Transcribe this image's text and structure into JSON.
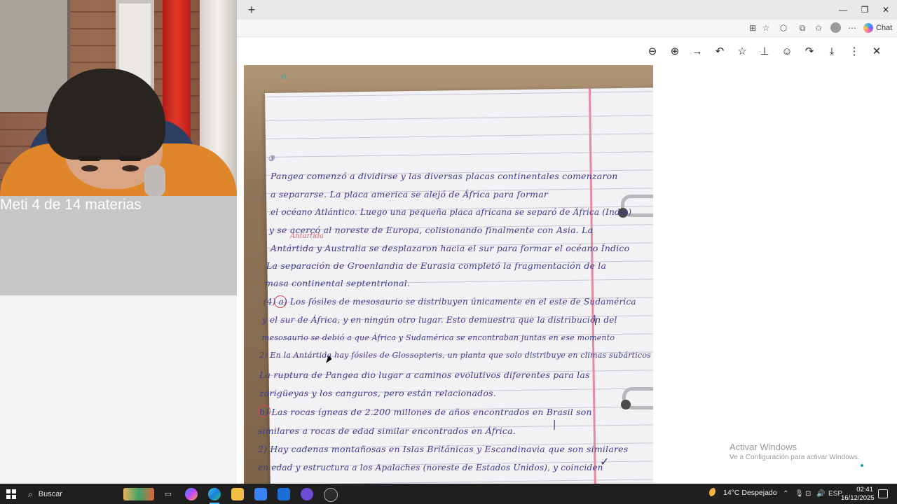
{
  "webcam": {
    "caption": "Meti 4 de 14 materias"
  },
  "browser": {
    "new_tab_icon": "plus-icon",
    "window_controls": [
      "minimize-icon",
      "restore-icon",
      "close-icon"
    ],
    "toolbar_icons": [
      "app-available-icon",
      "favorite-star-icon",
      "extensions-icon",
      "split-screen-icon",
      "favorites-icon",
      "profile-icon",
      "more-icon"
    ],
    "chat_label": "Chat"
  },
  "viewer": {
    "toolbar_icons": [
      "zoom-out-icon",
      "zoom-in-icon",
      "forward-icon",
      "reply-icon",
      "star-icon",
      "pin-icon",
      "emoji-icon",
      "share-icon",
      "download-icon",
      "more-vertical-icon",
      "close-icon"
    ]
  },
  "notebook": {
    "lines": [
      {
        "num": "③",
        "text": ""
      },
      {
        "text": "Pangea comenzó a dividirse y las diversas placas continentales comenzaron"
      },
      {
        "text": "a separarse. La placa america se alejó de África para formar"
      },
      {
        "text": "el océano Atlántico. Luego una pequeña placa africana se separó de África (India)"
      },
      {
        "text": "y se acercó al noreste de Europa, colisionando finalmente con Asia. La"
      },
      {
        "text": "Antártida y Australia se desplazaron hacia el sur para formar el océano Índico"
      },
      {
        "text": "La separación de Groenlandia de Eurasia completó la fragmentación de la"
      },
      {
        "text": "masa continental septentrional."
      },
      {
        "text": "(4) a) Los fósiles de mesosaurio se distribuyen únicamente en el este de Sudamérica"
      },
      {
        "text": "y el sur de África, y en ningún otro lugar. Esto demuestra que la distribución del"
      },
      {
        "text": "mesosaurio se debió a que África y Sudamérica se encontraban juntas en ese momento"
      },
      {
        "text": "2) En la Antártida hay fósiles de Glossopteris, un planta que solo distribuye en climas subárticos"
      },
      {
        "text": "La ruptura de Pangea dio lugar a caminos evolutivos diferentes para las"
      },
      {
        "text": "zarigüeyas y los canguros, pero están relacionados."
      },
      {
        "text": "b) Las rocas ígneas de 2.200 millones de años encontrados en Brasil son"
      },
      {
        "text": "similares a rocas de edad similar encontrados en África."
      },
      {
        "text": "2) Hay cadenas montañosas en Islas Británicas y Escandinavia que son similares"
      },
      {
        "text": "en edad y estructura a los Apalaches (noreste de Estados Unidos), y coinciden"
      }
    ],
    "margin_note": "Antártida"
  },
  "watermark": {
    "title": "Activar Windows",
    "subtitle": "Ve a Configuración para activar Windows."
  },
  "taskbar": {
    "search_placeholder": "Buscar",
    "weather": "14°C  Despejado",
    "language": "ESP",
    "time": "02:41",
    "date": "16/12/2025"
  }
}
